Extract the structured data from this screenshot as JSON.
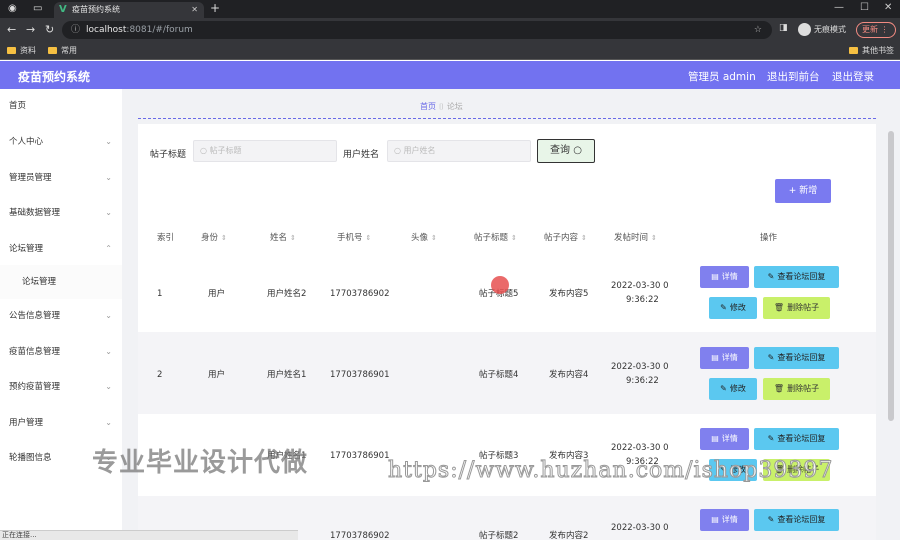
{
  "browser": {
    "tab_title": "疫苗预约系统",
    "url_host": "localhost",
    "url_rest": ":8081/#/forum",
    "incognito_label": "无痕模式",
    "update_label": "更新",
    "bookmarks": [
      "资料",
      "常用"
    ],
    "other_bookmarks": "其他书签"
  },
  "header": {
    "title": "疫苗预约系统",
    "admin_label": "管理员 admin",
    "back_label": "退出到前台",
    "logout_label": "退出登录"
  },
  "sidebar": {
    "items": [
      {
        "label": "首页"
      },
      {
        "label": "个人中心"
      },
      {
        "label": "管理员管理"
      },
      {
        "label": "基础数据管理"
      },
      {
        "label": "论坛管理"
      },
      {
        "label": "论坛管理"
      },
      {
        "label": "公告信息管理"
      },
      {
        "label": "疫苗信息管理"
      },
      {
        "label": "预约疫苗管理"
      },
      {
        "label": "用户管理"
      },
      {
        "label": "轮播图信息"
      }
    ]
  },
  "breadcrumb": {
    "home": "首页",
    "current": "论坛"
  },
  "search": {
    "title_label": "帖子标题",
    "title_placeholder": "帖子标题",
    "name_label": "用户姓名",
    "name_placeholder": "用户姓名",
    "query_label": "查询"
  },
  "add_label": "+ 新增",
  "table": {
    "columns": [
      "索引",
      "身份",
      "姓名",
      "手机号",
      "头像",
      "帖子标题",
      "帖子内容",
      "发帖时间",
      "操作"
    ],
    "actions": {
      "detail": "详情",
      "view": "查看论坛回复",
      "edit": "修改",
      "delete": "删除帖子"
    },
    "rows": [
      {
        "index": "1",
        "role": "用户",
        "name": "用户姓名2",
        "phone": "17703786902",
        "title": "帖子标题5",
        "content": "发布内容5",
        "time1": "2022-03-30 0",
        "time2": "9:36:22"
      },
      {
        "index": "2",
        "role": "用户",
        "name": "用户姓名1",
        "phone": "17703786901",
        "title": "帖子标题4",
        "content": "发布内容4",
        "time1": "2022-03-30 0",
        "time2": "9:36:22"
      },
      {
        "index": "",
        "role": "",
        "name": "用户姓名1",
        "phone": "17703786901",
        "title": "帖子标题3",
        "content": "发布内容3",
        "time1": "2022-03-30 0",
        "time2": "9:36:22"
      },
      {
        "index": "",
        "role": "",
        "name": "",
        "phone": "17703786902",
        "title": "帖子标题2",
        "content": "发布内容2",
        "time1": "2022-03-30 0",
        "time2": ""
      }
    ]
  },
  "watermark": {
    "text1": "专业毕业设计代做",
    "text2": "https://www.huzhan.com/ishop39397"
  },
  "status_text": "正在连接..."
}
